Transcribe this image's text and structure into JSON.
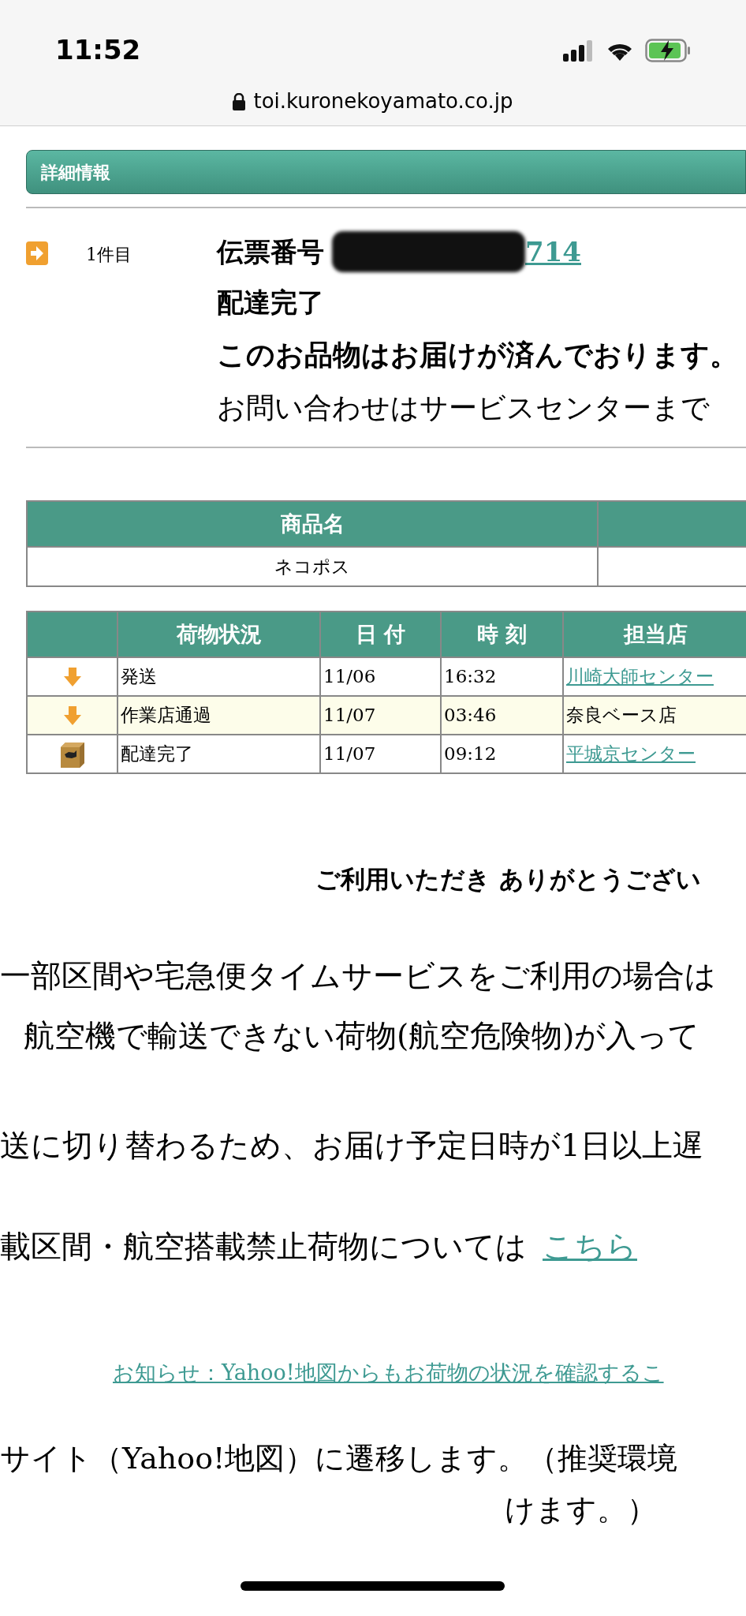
{
  "status_bar": {
    "time": "11:52"
  },
  "address_bar": {
    "url": "toi.kuronekoyamato.co.jp"
  },
  "section_header": "詳細情報",
  "shipment": {
    "index_label": "1件目",
    "tracking_label": "伝票番号",
    "tracking_redacted": true,
    "tracking_number": "714",
    "status": "配達完了",
    "message": "このお品物はお届けが済んでおります。",
    "inquiry": "お問い合わせはサービスセンターまで"
  },
  "product_table": {
    "columns": [
      "商品名"
    ],
    "rows": [
      [
        "ネコポス"
      ]
    ]
  },
  "history_table": {
    "columns": [
      "荷物状況",
      "日 付",
      "時 刻",
      "担当店"
    ],
    "rows": [
      {
        "kind": "transit",
        "status": "発送",
        "date": "11/06",
        "time": "16:32",
        "store": "川崎大師センター",
        "store_link": true,
        "highlighted": false
      },
      {
        "kind": "transit",
        "status": "作業店通過",
        "date": "11/07",
        "time": "03:46",
        "store": "奈良ベース店",
        "store_link": false,
        "highlighted": true
      },
      {
        "kind": "delivered",
        "status": "配達完了",
        "date": "11/07",
        "time": "09:12",
        "store": "平城京センター",
        "store_link": true,
        "highlighted": false
      }
    ]
  },
  "thanks": "ご利用いただき ありがとうござい",
  "notice_lines": [
    "一部区間や宅急便タイムサービスをご利用の場合は",
    "航空機で輸送できない荷物(航空危険物)が入って"
  ],
  "delay_line": "送に切り替わるため、お届け予定日時が1日以上遅",
  "restrictions": {
    "text": "載区間・航空搭載禁止荷物については",
    "link": "こちら"
  },
  "yahoo_notice_link": "お知らせ：Yahoo!地図からもお荷物の状況を確認するこ",
  "yahoo_lines": [
    "サイト（Yahoo!地図）に遷移します。（推奨環境",
    "けます。）"
  ]
}
